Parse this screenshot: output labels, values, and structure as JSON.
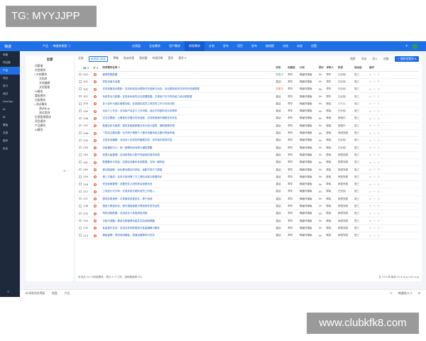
{
  "watermark_top": "TG: MYYJJPP",
  "watermark_bottom": "www.clubkfk8.com",
  "topbar": {
    "brand": "禅道",
    "crumb": "产品 ・ 禅道系统版 ⓘ",
    "nav": [
      {
        "label": "仪表盘",
        "active": false
      },
      {
        "label": "业务需求",
        "active": false
      },
      {
        "label": "用户需求",
        "active": false
      },
      {
        "label": "研发需求",
        "active": true
      },
      {
        "label": "计划",
        "active": false
      },
      {
        "label": "发布",
        "active": false
      },
      {
        "label": "项目",
        "active": false
      },
      {
        "label": "发布",
        "active": false
      },
      {
        "label": "路线图",
        "active": false
      },
      {
        "label": "文档",
        "active": false
      },
      {
        "label": "动态",
        "active": false
      },
      {
        "label": "设置",
        "active": false
      }
    ],
    "plus_icon": "+",
    "user_initials": "管理"
  },
  "sidebar": {
    "items": [
      {
        "label": "地盘",
        "active": false
      },
      {
        "label": "项目集",
        "active": false
      },
      {
        "label": "产品",
        "active": true
      },
      {
        "label": "项目",
        "active": false
      },
      {
        "label": "执行",
        "active": false
      },
      {
        "label": "测试",
        "active": false
      },
      {
        "label": "DevOps",
        "active": false
      },
      {
        "label": "AI",
        "active": false
      },
      {
        "label": "BI",
        "active": false
      },
      {
        "label": "看板",
        "active": false
      },
      {
        "label": "文档",
        "active": false
      },
      {
        "label": "组织",
        "active": false
      },
      {
        "label": "后台",
        "active": false
      }
    ],
    "collapse_icon": "«"
  },
  "tree": {
    "title": "全部",
    "nodes": [
      {
        "label": "问题域",
        "depth": 0,
        "caret": ""
      },
      {
        "label": "学堂模块",
        "depth": 0,
        "caret": ""
      },
      {
        "label": "文档模块",
        "depth": 0,
        "caret": "▾"
      },
      {
        "label": "文档库",
        "depth": 1,
        "caret": ""
      },
      {
        "label": "文档编辑",
        "depth": 1,
        "caret": ""
      },
      {
        "label": "文档管理",
        "depth": 1,
        "caret": ""
      },
      {
        "label": "AI模块",
        "depth": 0,
        "caret": ""
      },
      {
        "label": "看板模块",
        "depth": 0,
        "caret": ""
      },
      {
        "label": "白板模块",
        "depth": 0,
        "caret": ""
      },
      {
        "label": "测试模块",
        "depth": 0,
        "caret": "▾"
      },
      {
        "label": "测试Bug",
        "depth": 1,
        "caret": ""
      },
      {
        "label": "测试用例",
        "depth": 1,
        "caret": ""
      },
      {
        "label": "反馈管理模块",
        "depth": 0,
        "caret": ""
      },
      {
        "label": "项目模块",
        "depth": 0,
        "caret": ""
      },
      {
        "label": "产品模块",
        "depth": 0,
        "caret": ""
      },
      {
        "label": "AI模块",
        "depth": 0,
        "caret": ""
      }
    ],
    "tools": "⚙ ⋯"
  },
  "filters": {
    "tabs": [
      {
        "label": "全部",
        "count": "",
        "active": false
      },
      {
        "label": "未关闭",
        "count": "213",
        "active": true
      },
      {
        "label": "草稿",
        "count": "",
        "active": false
      },
      {
        "label": "指派给我",
        "count": "",
        "active": false
      },
      {
        "label": "我创建",
        "count": "",
        "active": false
      },
      {
        "label": "待我评审",
        "count": "",
        "active": false
      },
      {
        "label": "更多",
        "count": "",
        "active": false
      },
      {
        "label": "更多 ▾",
        "count": "",
        "active": false
      }
    ],
    "right": [
      "搜索",
      "导出",
      "导入",
      "创建"
    ],
    "primary_button": "+ 提研发需求 ▾"
  },
  "table": {
    "headers": [
      "",
      "ID ⇕",
      "P ⇕",
      "研发需求名称 ⇕",
      "",
      "",
      "",
      "状态",
      "创建者",
      "计划",
      "预计",
      "评审人",
      "阶段",
      "指派给",
      "",
      "操作"
    ],
    "rows": [
      {
        "id": "442",
        "pri": "1",
        "title": "管理权限配置",
        "status": "研发中",
        "creator": "李华",
        "plan": "禅道开源版",
        "est": "0h",
        "reviewer": "李华",
        "stage": "已计划",
        "assignee": "张三"
      },
      {
        "id": "441",
        "pri": "1",
        "title": "导航页面与设置",
        "status": "激活",
        "creator": "李华",
        "plan": "禅道开源版",
        "est": "0h",
        "reviewer": "李华",
        "stage": "已计划",
        "assignee": "张三"
      },
      {
        "id": "302",
        "pri": "1",
        "title": "任务进度自动更新：支持系统自动更新任务进度与状态，自动更新相关任务的完成度数据",
        "status": "变更中",
        "creator": "李华",
        "plan": "禅道开源版",
        "est": "0h",
        "reviewer": "李华",
        "stage": "已计划",
        "assignee": "张三"
      },
      {
        "id": "301",
        "pri": "1",
        "title": "系统导出与配置：支持多系统导出与配置数据，方便用户在不同系统之间迁移数据",
        "status": "激活",
        "creator": "李华",
        "plan": "禅道开源版",
        "est": "0h",
        "reviewer": "李华",
        "stage": "已计划",
        "assignee": "张三"
      },
      {
        "id": "300",
        "pri": "1",
        "title": "多人协作与团队管理功能，支持团队成员之间协同工作与任务分配",
        "status": "激活",
        "creator": "李华",
        "plan": "禅道开源版",
        "est": "0h",
        "reviewer": "陈晓",
        "stage": "未开始",
        "assignee": "张三"
      },
      {
        "id": "299",
        "pri": "1",
        "title": "自定义工作流：支持用户自定义工作流程，适应不同团队的业务需求",
        "status": "激活",
        "creator": "李华",
        "plan": "禅道开源版",
        "est": "0h",
        "reviewer": "陈晓",
        "stage": "已计划",
        "assignee": "张三"
      },
      {
        "id": "298",
        "pri": "1",
        "title": "交互式看板：以看板形式展示任务进度，支持拖拽操作调整任务状态",
        "status": "激活",
        "creator": "李华",
        "plan": "禅道开源版",
        "est": "0h",
        "reviewer": "陈晓",
        "stage": "研发中",
        "assignee": "张三"
      },
      {
        "id": "297",
        "pri": "1",
        "title": "数据分析与报表：提供多维度数据分析与统计报表，辅助管理决策",
        "status": "激活",
        "creator": "李华",
        "plan": "禅道开源版",
        "est": "0h",
        "reviewer": "陈晓",
        "stage": "研发中",
        "assignee": "张三"
      },
      {
        "id": "296",
        "pri": "1",
        "title": "个性化主题设置：允许用户根据个人喜好设置系统主题与界面风格",
        "status": "激活",
        "creator": "李华",
        "plan": "禅道开源版",
        "est": "0h",
        "reviewer": "陈晓",
        "stage": "测试完成",
        "assignee": "张三"
      },
      {
        "id": "295",
        "pri": "1",
        "title": "文档在线编辑：支持多人在线协同编辑文档，实时保存修改内容",
        "status": "激活",
        "creator": "李华",
        "plan": "禅道开源版",
        "est": "0h",
        "reviewer": "陈晓",
        "stage": "已计划",
        "assignee": "张三"
      },
      {
        "id": "264",
        "pri": "1",
        "title": "消息通知中心：统一管理系统消息与通知提醒",
        "status": "激活",
        "creator": "李华",
        "plan": "禅道开源版",
        "est": "0h",
        "reviewer": "陈晓",
        "stage": "已计划",
        "assignee": "张三"
      },
      {
        "id": "263",
        "pri": "1",
        "title": "权限分级管理：支持按角色分配不同级别的操作权限",
        "status": "激活",
        "creator": "李华",
        "plan": "禅道开源版",
        "est": "0h",
        "reviewer": "陈晓",
        "stage": "研发完成",
        "assignee": "张三"
      },
      {
        "id": "261",
        "pri": "1",
        "title": "数据备份与恢复：定期自动备份系统数据，支持一键恢复",
        "status": "激活",
        "creator": "李华",
        "plan": "禅道开源版",
        "est": "0h",
        "reviewer": "陈晓",
        "stage": "研发完成",
        "assignee": "张三"
      },
      {
        "id": "260",
        "pri": "1",
        "title": "移动端适配：优化移动端访问体验，适配不同尺寸屏幕",
        "status": "激活",
        "creator": "李华",
        "plan": "禅道开源版",
        "est": "0h",
        "reviewer": "陈晓",
        "stage": "研发完成",
        "assignee": "张三"
      },
      {
        "id": "259",
        "pri": "1",
        "title": "第三方集成：支持与常用第三方工具的对接与数据同步",
        "status": "激活",
        "creator": "李华",
        "plan": "禅道开源版",
        "est": "0h",
        "reviewer": "陈晓",
        "stage": "研发完成",
        "assignee": "张三"
      },
      {
        "id": "258",
        "pri": "1",
        "title": "任务依赖管理：设置任务之间的前后依赖关系",
        "status": "激活",
        "creator": "李华",
        "plan": "禅道开源版",
        "est": "0h",
        "reviewer": "陈晓",
        "stage": "研发完成",
        "assignee": "张三"
      },
      {
        "id": "257",
        "pri": "1",
        "title": "工时统计与分析：记录并统计团队成员工时投入",
        "status": "激活",
        "creator": "李华",
        "plan": "禅道开源版",
        "est": "0h",
        "reviewer": "陈晓",
        "stage": "已计划",
        "assignee": "张三"
      },
      {
        "id": "237",
        "pri": "1",
        "title": "需求变更追踪：记录需求变更历史，便于追溯",
        "status": "激活",
        "creator": "李华",
        "plan": "禅道开源版",
        "est": "0h",
        "reviewer": "陈晓",
        "stage": "研发完成",
        "assignee": "张三"
      },
      {
        "id": "236",
        "pri": "1",
        "title": "搜索与筛选优化：提升搜索速度与筛选条件的灵活性",
        "status": "激活",
        "creator": "李华",
        "plan": "禅道开源版",
        "est": "0h",
        "reviewer": "陈晓",
        "stage": "研发完成",
        "assignee": "张三"
      },
      {
        "id": "235",
        "pri": "1",
        "title": "审批流程配置：支持自定义多级审批流程",
        "status": "激活",
        "creator": "李华",
        "plan": "禅道开源版",
        "est": "0h",
        "reviewer": "陈晓",
        "stage": "研发完成",
        "assignee": "张三"
      },
      {
        "id": "234",
        "pri": "1",
        "title": "日程与提醒：集成日程管理功能并支持到期提醒",
        "status": "激活",
        "creator": "李华",
        "plan": "禅道开源版",
        "est": "0h",
        "reviewer": "陈晓",
        "stage": "研发完成",
        "assignee": "张三"
      },
      {
        "id": "233",
        "pri": "1",
        "title": "批量操作支持：支持对多条数据进行批量编辑与删除",
        "status": "激活",
        "creator": "李华",
        "plan": "禅道开源版",
        "est": "0h",
        "reviewer": "陈晓",
        "stage": "研发完成",
        "assignee": "张三"
      },
      {
        "id": "214",
        "pri": "1",
        "title": "模板管理：提供常用模板，快速创建需求与任务",
        "status": "激活",
        "creator": "李华",
        "plan": "禅道开源版",
        "est": "0h",
        "reviewer": "陈晓",
        "stage": "研发完成",
        "assignee": "张三"
      }
    ],
    "actions": "⇄ ✎ ⎘ ⋯"
  },
  "footer": {
    "summary": "本页共 20 个研发需求，预计 0 个工时，用例覆盖率 0%",
    "pager": "共 213 项   每页 20 ▾   |◂ ◂ 1/11 ▸ ▸|"
  },
  "bottombar": {
    "items": [
      "⊞ 研发综合界面",
      "地盘",
      "产品"
    ],
    "right": [
      "↻",
      "禅道版21.5",
      "⚙"
    ]
  }
}
